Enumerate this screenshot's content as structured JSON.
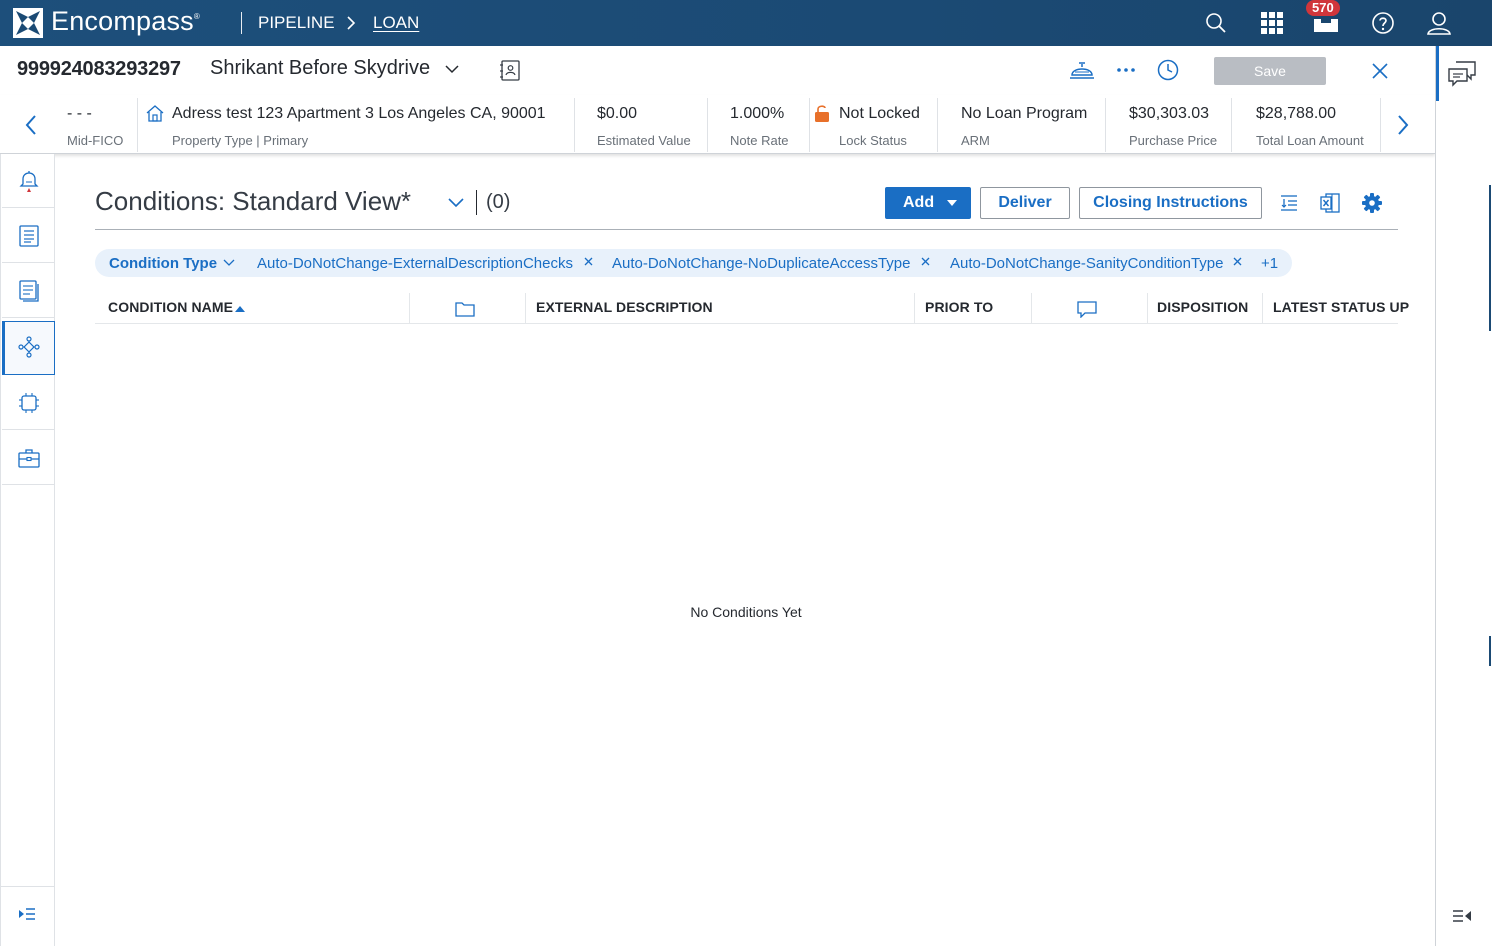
{
  "topnav": {
    "brand": "Encompass",
    "brand_mark": "®",
    "breadcrumb_pipeline": "PIPELINE",
    "breadcrumb_loan": "LOAN",
    "notification_count": "570",
    "icons": [
      "search-icon",
      "apps-grid-icon",
      "inbox-icon",
      "help-icon",
      "user-icon"
    ]
  },
  "loan": {
    "number": "999924083293297",
    "borrower": "Shrikant Before Skydrive",
    "save_label": "Save"
  },
  "info": {
    "fico_value": "- - -",
    "fico_label": "Mid-FICO",
    "address_value": "Adress test 123 Apartment 3 Los Angeles CA, 90001",
    "address_label": "Property Type | Primary",
    "estimated_value": "$0.00",
    "estimated_label": "Estimated Value",
    "note_rate": "1.000%",
    "note_rate_label": "Note Rate",
    "lock_value": "Not Locked",
    "lock_label": "Lock Status",
    "program_value": "No Loan Program",
    "program_label": "ARM",
    "purchase_value": "$30,303.03",
    "purchase_label": "Purchase Price",
    "total_value": "$28,788.00",
    "total_label": "Total Loan Amount"
  },
  "conditions": {
    "title": "Conditions: Standard View*",
    "count": "(0)",
    "add_label": "Add",
    "deliver_label": "Deliver",
    "closing_label": "Closing Instructions",
    "filter_label": "Condition Type",
    "filters": [
      "Auto-DoNotChange-ExternalDescriptionChecks",
      "Auto-DoNotChange-NoDuplicateAccessType",
      "Auto-DoNotChange-SanityConditionType"
    ],
    "more_filters": "+1",
    "columns": {
      "name": "CONDITION NAME",
      "external": "EXTERNAL DESCRIPTION",
      "prior": "PRIOR TO",
      "disposition": "DISPOSITION",
      "latest": "LATEST STATUS UP"
    },
    "empty_text": "No Conditions Yet"
  },
  "colors": {
    "nav_bg": "#1b4a74",
    "accent": "#1a6ec4",
    "lock_orange": "#e8702a",
    "badge_red": "#d0363b"
  }
}
